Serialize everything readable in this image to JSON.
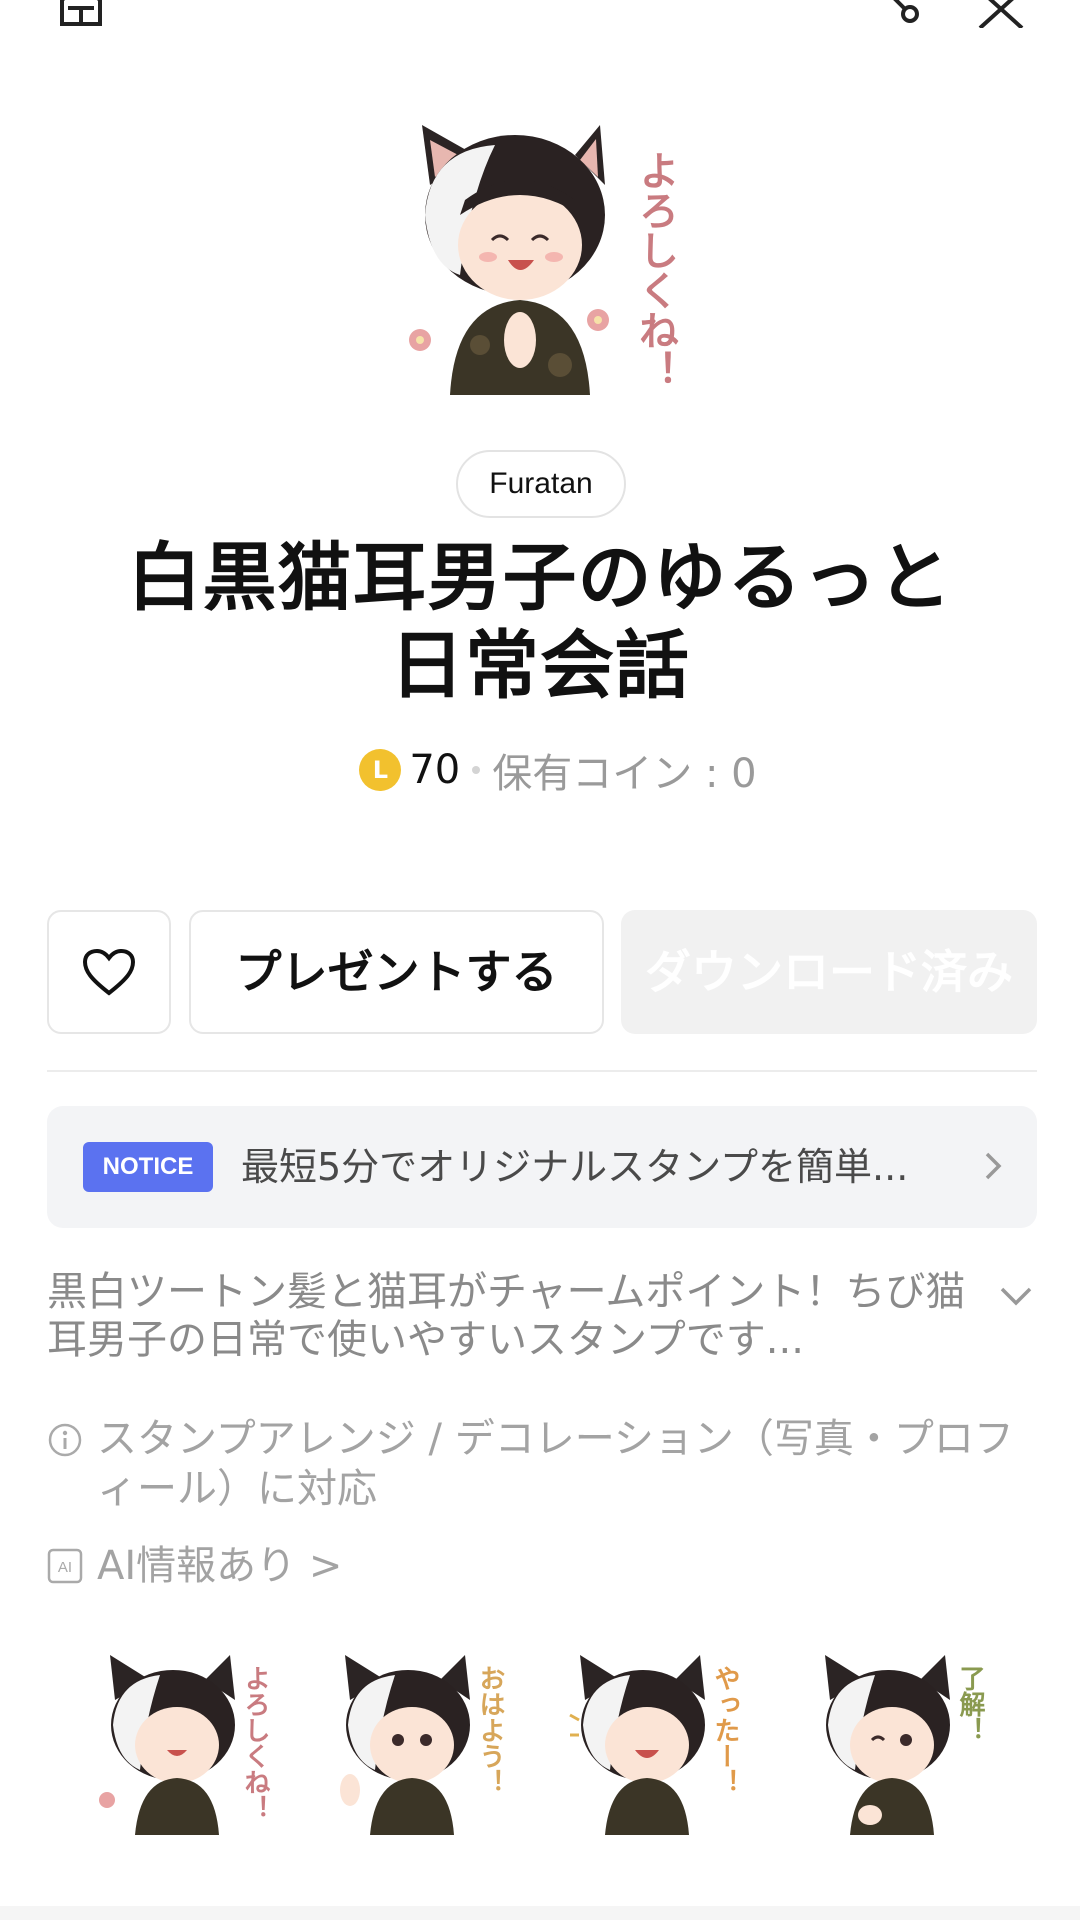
{
  "header": {
    "icons": [
      "home-icon",
      "share-icon",
      "close-icon"
    ]
  },
  "product": {
    "author": "Furatan",
    "title": "白黒猫耳男子のゆるっと日常会話",
    "price": "70",
    "coin_letter": "L",
    "owned_coins": "保有コイン : 0"
  },
  "actions": {
    "gift_label": "プレゼントする",
    "download_label": "ダウンロード済み"
  },
  "notice": {
    "badge": "NOTICE",
    "text": "最短5分でオリジナルスタンプを簡単..."
  },
  "description": "黒白ツートン髪と猫耳がチャームポイント！ちび猫耳男子の日常で使いやすいスタンプです...",
  "info": {
    "arrange": "スタンプアレンジ / デコレーション（写真・プロフィール）に対応",
    "ai": "AI情報あり >",
    "ai_icon_text": "AI"
  },
  "stickers": [
    {
      "caption": "よろしくね！"
    },
    {
      "caption": "おはよう！"
    },
    {
      "caption": "やったー！"
    },
    {
      "caption": "了解！"
    }
  ],
  "hero_caption": "よろしくね！",
  "colors": {
    "notice_badge": "#5b72f0",
    "coin": "#f2c12e",
    "download_bg": "#f1f1f1"
  }
}
